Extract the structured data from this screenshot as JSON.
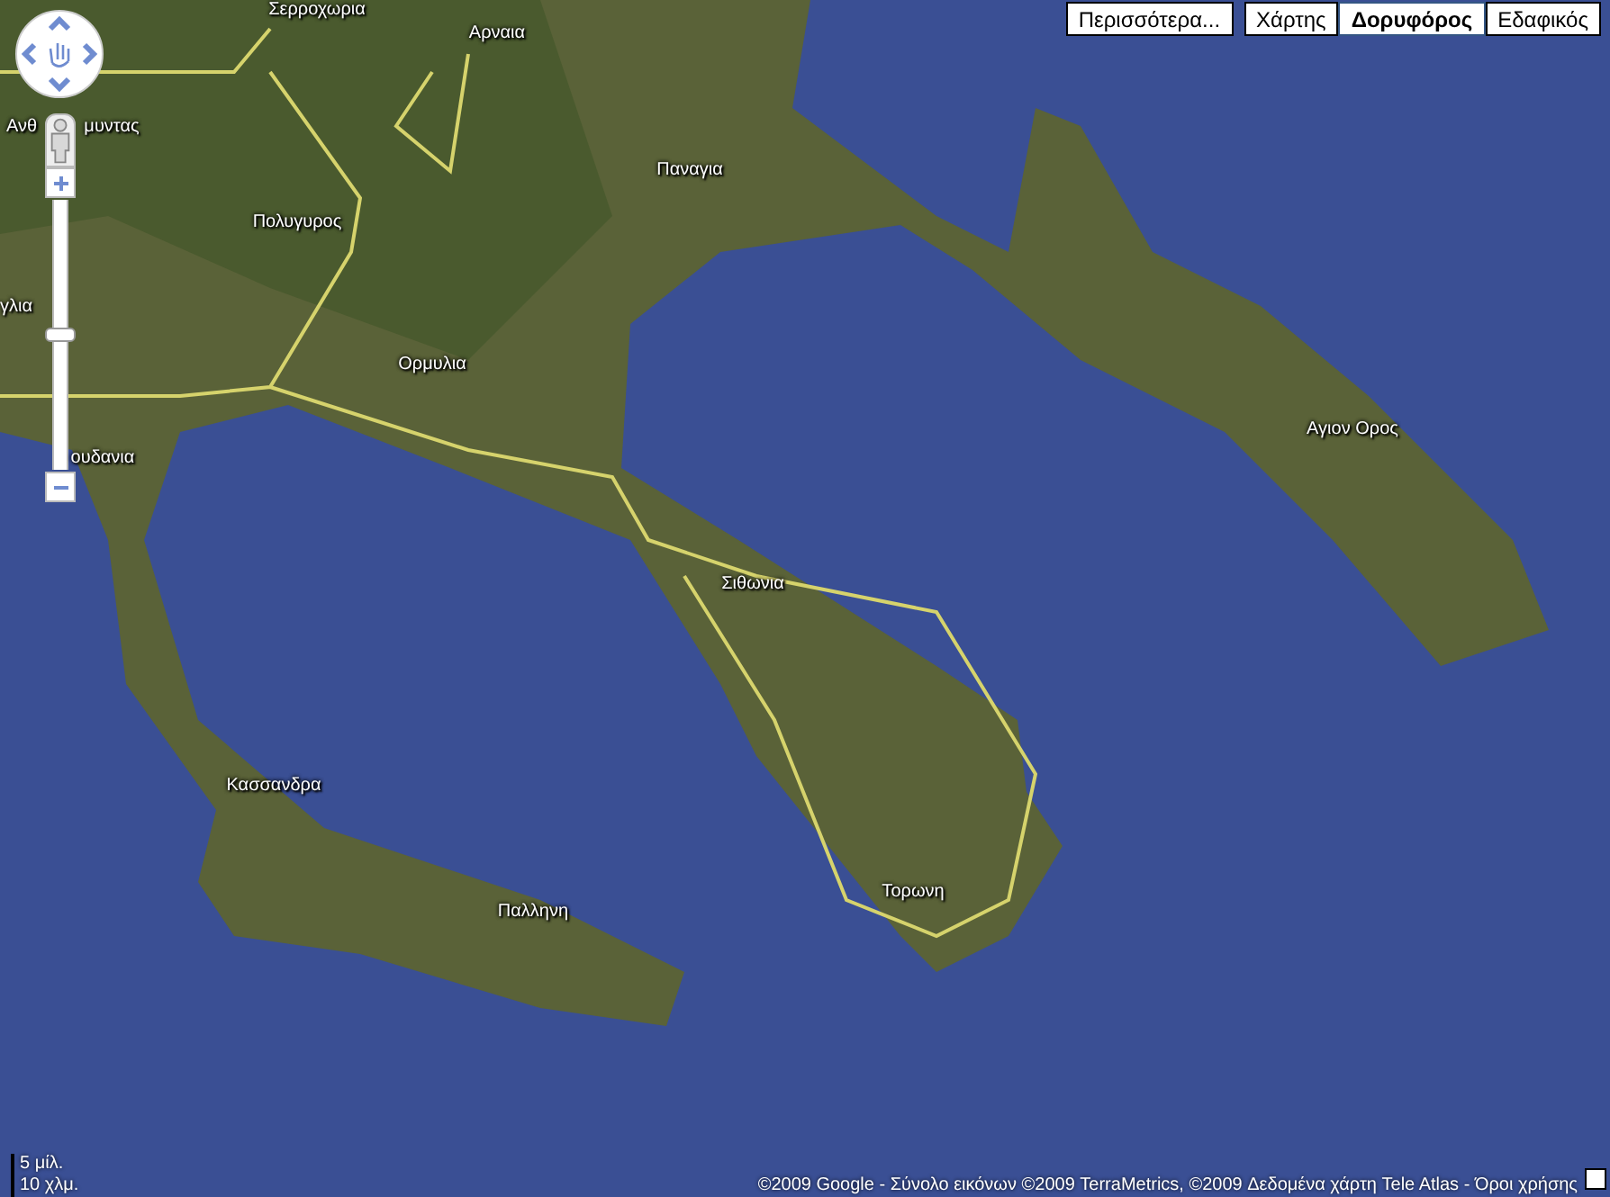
{
  "map": {
    "labels": [
      {
        "text": "Σερροχωρια"
      },
      {
        "text": "Αρναια"
      },
      {
        "text": "Ανθ"
      },
      {
        "text": "μυντας"
      },
      {
        "text": "Πολυγυρος"
      },
      {
        "text": "γλια"
      },
      {
        "text": "Ορμυλια"
      },
      {
        "text": "ουδανια"
      },
      {
        "text": "Παναγια"
      },
      {
        "text": "Σιθωνια"
      },
      {
        "text": "Κασσανδρα"
      },
      {
        "text": "Παλληνη"
      },
      {
        "text": "Τορωνη"
      },
      {
        "text": "Αγιον Ορος"
      }
    ]
  },
  "more_button": {
    "label": "Περισσότερα..."
  },
  "map_types": [
    {
      "label": "Χάρτης",
      "selected": false
    },
    {
      "label": "Δορυφόρος",
      "selected": true
    },
    {
      "label": "Εδαφικός",
      "selected": false
    }
  ],
  "zoom_control": {
    "level": 0.5
  },
  "scale": {
    "miles": "5 μίλ.",
    "km": "10 χλμ."
  },
  "copyright": "©2009 Google - Σύνολο εικόνων ©2009 TerraMetrics, ©2009 Δεδομένα χάρτη Tele Atlas - Όροι χρήσης"
}
